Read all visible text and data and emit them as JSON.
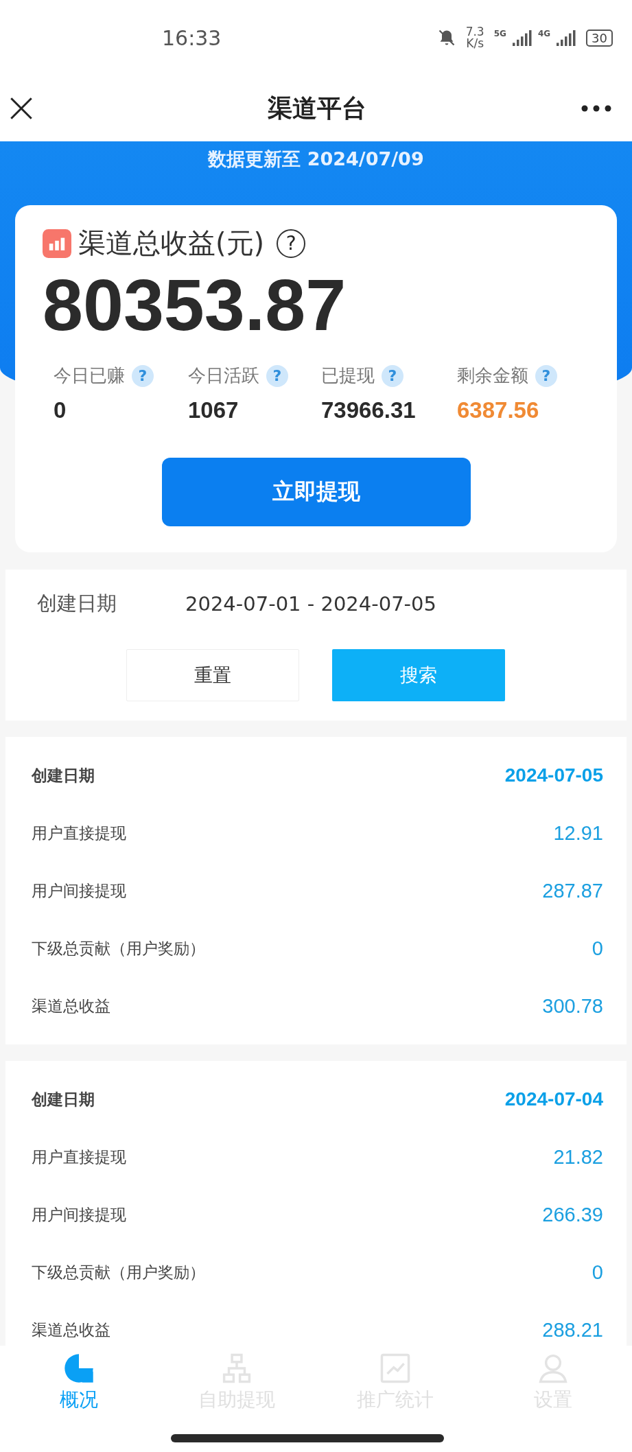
{
  "status_bar": {
    "time": "16:33",
    "net_speed": [
      "7.3",
      "K/s"
    ],
    "network_labels": [
      "5G",
      "4G"
    ],
    "battery": "30"
  },
  "header": {
    "title": "渠道平台"
  },
  "banner": {
    "text": "数据更新至 2024/07/09"
  },
  "summary": {
    "title": "渠道总收益(元)",
    "help": "?",
    "amount": "80353.87",
    "stats": [
      {
        "label": "今日已赚",
        "value": "0",
        "color": "#2b2b2b"
      },
      {
        "label": "今日活跃",
        "value": "1067",
        "color": "#2b2b2b"
      },
      {
        "label": "已提现",
        "value": "73966.31",
        "color": "#2b2b2b"
      },
      {
        "label": "剩余金额",
        "value": "6387.56",
        "color": "#f08a34"
      }
    ],
    "stat_help": "?",
    "withdraw_button": "立即提现"
  },
  "filter": {
    "label": "创建日期",
    "value": "2024-07-01 - 2024-07-05",
    "reset_button": "重置",
    "search_button": "搜索"
  },
  "records": [
    {
      "date_label": "创建日期",
      "date": "2024-07-05",
      "rows": [
        {
          "label": "用户直接提现",
          "value": "12.91"
        },
        {
          "label": "用户间接提现",
          "value": "287.87"
        },
        {
          "label": "下级总贡献（用户奖励）",
          "value": "0"
        },
        {
          "label": "渠道总收益",
          "value": "300.78"
        }
      ]
    },
    {
      "date_label": "创建日期",
      "date": "2024-07-04",
      "rows": [
        {
          "label": "用户直接提现",
          "value": "21.82"
        },
        {
          "label": "用户间接提现",
          "value": "266.39"
        },
        {
          "label": "下级总贡献（用户奖励）",
          "value": "0"
        },
        {
          "label": "渠道总收益",
          "value": "288.21"
        }
      ]
    }
  ],
  "tab_bar": {
    "items": [
      {
        "label": "概况",
        "selected": true
      },
      {
        "label": "自助提现",
        "selected": false
      },
      {
        "label": "推广统计",
        "selected": false
      },
      {
        "label": "设置",
        "selected": false
      }
    ]
  }
}
